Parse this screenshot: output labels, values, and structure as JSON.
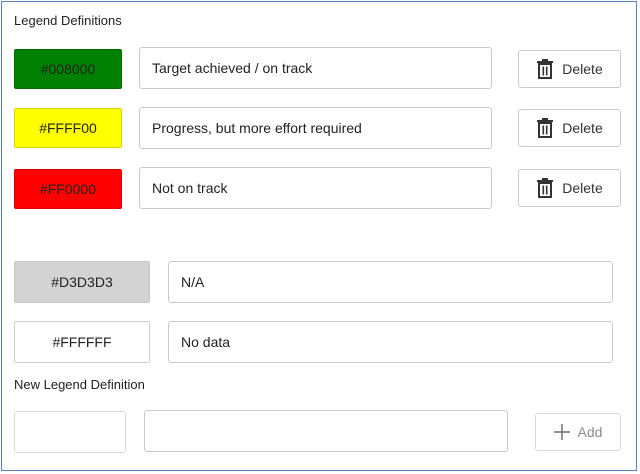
{
  "legend_definitions": {
    "title": "Legend Definitions",
    "rows": [
      {
        "color": "#008000",
        "label": "Target achieved / on track",
        "delete_label": "Delete"
      },
      {
        "color": "#FFFF00",
        "label": "Progress, but more effort required",
        "delete_label": "Delete"
      },
      {
        "color": "#FF0000",
        "label": "Not on track",
        "delete_label": "Delete"
      }
    ]
  },
  "default_definitions": [
    {
      "color": "#D3D3D3",
      "label": "N/A"
    },
    {
      "color": "#FFFFFF",
      "label": "No data"
    }
  ],
  "new_legend": {
    "title": "New Legend Definition",
    "color_value": "",
    "label_value": "",
    "add_label": "Add"
  },
  "icons": {
    "delete": "trash-icon",
    "add": "plus-icon"
  },
  "colors": {
    "panel_border": "#5b7fc7",
    "input_border": "#c9c9c9"
  }
}
